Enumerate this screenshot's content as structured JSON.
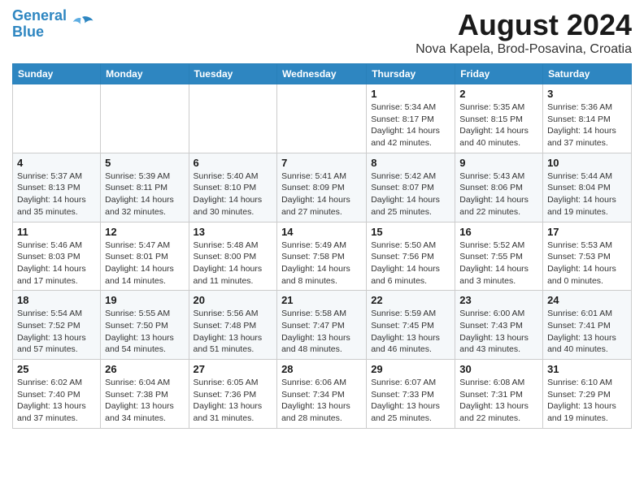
{
  "header": {
    "logo_line1": "General",
    "logo_line2": "Blue",
    "main_title": "August 2024",
    "subtitle": "Nova Kapela, Brod-Posavina, Croatia"
  },
  "days_of_week": [
    "Sunday",
    "Monday",
    "Tuesday",
    "Wednesday",
    "Thursday",
    "Friday",
    "Saturday"
  ],
  "weeks": [
    [
      {
        "day": "",
        "info": ""
      },
      {
        "day": "",
        "info": ""
      },
      {
        "day": "",
        "info": ""
      },
      {
        "day": "",
        "info": ""
      },
      {
        "day": "1",
        "info": "Sunrise: 5:34 AM\nSunset: 8:17 PM\nDaylight: 14 hours\nand 42 minutes."
      },
      {
        "day": "2",
        "info": "Sunrise: 5:35 AM\nSunset: 8:15 PM\nDaylight: 14 hours\nand 40 minutes."
      },
      {
        "day": "3",
        "info": "Sunrise: 5:36 AM\nSunset: 8:14 PM\nDaylight: 14 hours\nand 37 minutes."
      }
    ],
    [
      {
        "day": "4",
        "info": "Sunrise: 5:37 AM\nSunset: 8:13 PM\nDaylight: 14 hours\nand 35 minutes."
      },
      {
        "day": "5",
        "info": "Sunrise: 5:39 AM\nSunset: 8:11 PM\nDaylight: 14 hours\nand 32 minutes."
      },
      {
        "day": "6",
        "info": "Sunrise: 5:40 AM\nSunset: 8:10 PM\nDaylight: 14 hours\nand 30 minutes."
      },
      {
        "day": "7",
        "info": "Sunrise: 5:41 AM\nSunset: 8:09 PM\nDaylight: 14 hours\nand 27 minutes."
      },
      {
        "day": "8",
        "info": "Sunrise: 5:42 AM\nSunset: 8:07 PM\nDaylight: 14 hours\nand 25 minutes."
      },
      {
        "day": "9",
        "info": "Sunrise: 5:43 AM\nSunset: 8:06 PM\nDaylight: 14 hours\nand 22 minutes."
      },
      {
        "day": "10",
        "info": "Sunrise: 5:44 AM\nSunset: 8:04 PM\nDaylight: 14 hours\nand 19 minutes."
      }
    ],
    [
      {
        "day": "11",
        "info": "Sunrise: 5:46 AM\nSunset: 8:03 PM\nDaylight: 14 hours\nand 17 minutes."
      },
      {
        "day": "12",
        "info": "Sunrise: 5:47 AM\nSunset: 8:01 PM\nDaylight: 14 hours\nand 14 minutes."
      },
      {
        "day": "13",
        "info": "Sunrise: 5:48 AM\nSunset: 8:00 PM\nDaylight: 14 hours\nand 11 minutes."
      },
      {
        "day": "14",
        "info": "Sunrise: 5:49 AM\nSunset: 7:58 PM\nDaylight: 14 hours\nand 8 minutes."
      },
      {
        "day": "15",
        "info": "Sunrise: 5:50 AM\nSunset: 7:56 PM\nDaylight: 14 hours\nand 6 minutes."
      },
      {
        "day": "16",
        "info": "Sunrise: 5:52 AM\nSunset: 7:55 PM\nDaylight: 14 hours\nand 3 minutes."
      },
      {
        "day": "17",
        "info": "Sunrise: 5:53 AM\nSunset: 7:53 PM\nDaylight: 14 hours\nand 0 minutes."
      }
    ],
    [
      {
        "day": "18",
        "info": "Sunrise: 5:54 AM\nSunset: 7:52 PM\nDaylight: 13 hours\nand 57 minutes."
      },
      {
        "day": "19",
        "info": "Sunrise: 5:55 AM\nSunset: 7:50 PM\nDaylight: 13 hours\nand 54 minutes."
      },
      {
        "day": "20",
        "info": "Sunrise: 5:56 AM\nSunset: 7:48 PM\nDaylight: 13 hours\nand 51 minutes."
      },
      {
        "day": "21",
        "info": "Sunrise: 5:58 AM\nSunset: 7:47 PM\nDaylight: 13 hours\nand 48 minutes."
      },
      {
        "day": "22",
        "info": "Sunrise: 5:59 AM\nSunset: 7:45 PM\nDaylight: 13 hours\nand 46 minutes."
      },
      {
        "day": "23",
        "info": "Sunrise: 6:00 AM\nSunset: 7:43 PM\nDaylight: 13 hours\nand 43 minutes."
      },
      {
        "day": "24",
        "info": "Sunrise: 6:01 AM\nSunset: 7:41 PM\nDaylight: 13 hours\nand 40 minutes."
      }
    ],
    [
      {
        "day": "25",
        "info": "Sunrise: 6:02 AM\nSunset: 7:40 PM\nDaylight: 13 hours\nand 37 minutes."
      },
      {
        "day": "26",
        "info": "Sunrise: 6:04 AM\nSunset: 7:38 PM\nDaylight: 13 hours\nand 34 minutes."
      },
      {
        "day": "27",
        "info": "Sunrise: 6:05 AM\nSunset: 7:36 PM\nDaylight: 13 hours\nand 31 minutes."
      },
      {
        "day": "28",
        "info": "Sunrise: 6:06 AM\nSunset: 7:34 PM\nDaylight: 13 hours\nand 28 minutes."
      },
      {
        "day": "29",
        "info": "Sunrise: 6:07 AM\nSunset: 7:33 PM\nDaylight: 13 hours\nand 25 minutes."
      },
      {
        "day": "30",
        "info": "Sunrise: 6:08 AM\nSunset: 7:31 PM\nDaylight: 13 hours\nand 22 minutes."
      },
      {
        "day": "31",
        "info": "Sunrise: 6:10 AM\nSunset: 7:29 PM\nDaylight: 13 hours\nand 19 minutes."
      }
    ]
  ]
}
